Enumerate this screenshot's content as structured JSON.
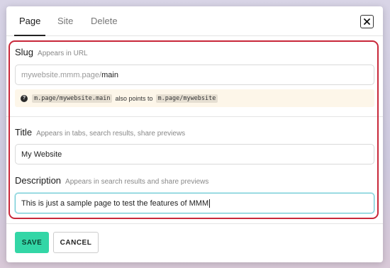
{
  "tabs": [
    {
      "label": "Page"
    },
    {
      "label": "Site"
    },
    {
      "label": "Delete"
    }
  ],
  "close_label": "×",
  "slug": {
    "label": "Slug",
    "hint": "Appears in URL",
    "prefix": "mywebsite.mmm.page/",
    "value": "main"
  },
  "notice": {
    "icon": "?",
    "domain_a": "m.page/mywebsite.main",
    "middle": "also points to",
    "domain_b": "m.page/mywebsite"
  },
  "title": {
    "label": "Title",
    "hint": "Appears in tabs, search results, share previews",
    "value": "My Website"
  },
  "description": {
    "label": "Description",
    "hint": "Appears in search results and share previews",
    "value": "This is just a sample page to test the features of MMM"
  },
  "buttons": {
    "save": "SAVE",
    "cancel": "CANCEL"
  },
  "colors": {
    "highlight": "#c8283a",
    "save_bg": "#33d6a6",
    "notice_bg": "#fdf6e9",
    "focus_border": "#6fc9d3"
  }
}
